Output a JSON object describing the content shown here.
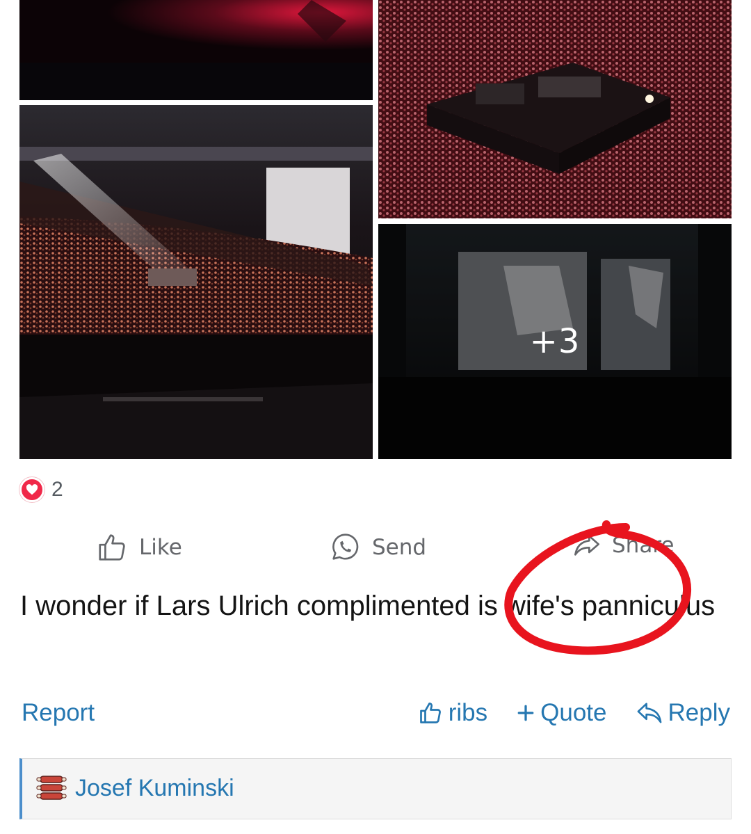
{
  "embed": {
    "more_photos_label": "+3",
    "reaction_count": "2",
    "actions": {
      "like": "Like",
      "send": "Send",
      "share": "Share"
    }
  },
  "post": {
    "text": "I wonder if Lars Ulrich complimented  is wife's panniculus"
  },
  "footer": {
    "report": "Report",
    "reaction": "ribs",
    "quote": "Quote",
    "reply": "Reply"
  },
  "quote_block": {
    "author": "Josef Kuminski"
  },
  "icons": {
    "heart": "heart-icon",
    "like": "thumbs-up-icon",
    "send": "whatsapp-icon",
    "share": "share-arrow-icon",
    "quote": "plus-icon",
    "reply": "reply-arrow-icon",
    "author_avatar": "ribs-icon"
  },
  "colors": {
    "link": "#2577b1",
    "heart": "#f02849",
    "annotation": "#e8141e",
    "quote_border": "#4b8ecb"
  }
}
